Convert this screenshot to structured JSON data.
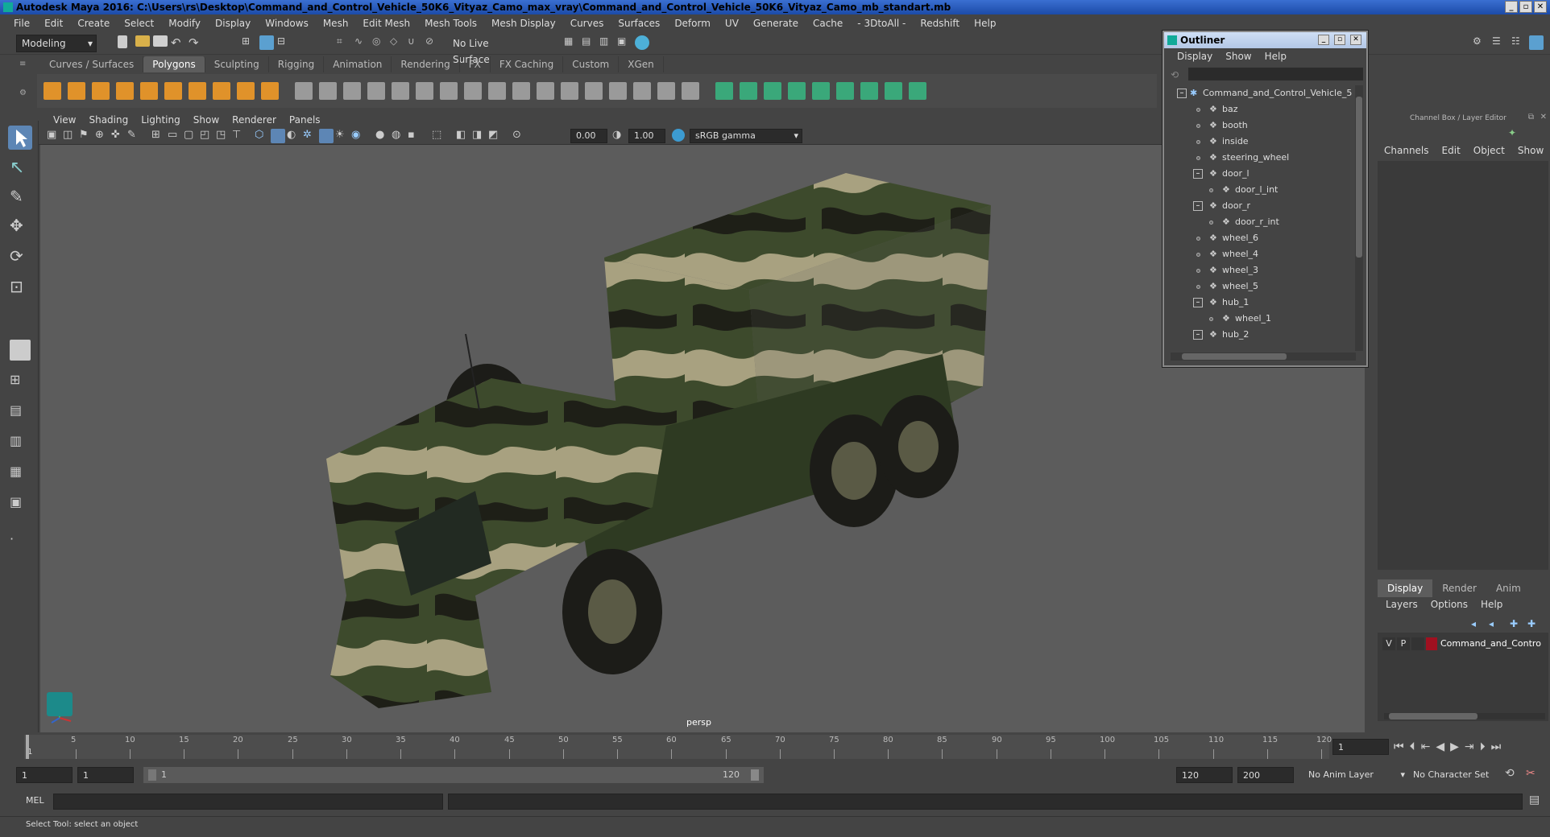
{
  "title": "Autodesk Maya 2016: C:\\Users\\rs\\Desktop\\Command_and_Control_Vehicle_50K6_Vityaz_Camo_max_vray\\Command_and_Control_Vehicle_50K6_Vityaz_Camo_mb_standart.mb",
  "menu": [
    "File",
    "Edit",
    "Create",
    "Select",
    "Modify",
    "Display",
    "Windows",
    "Mesh",
    "Edit Mesh",
    "Mesh Tools",
    "Mesh Display",
    "Curves",
    "Surfaces",
    "Deform",
    "UV",
    "Generate",
    "Cache",
    "- 3DtoAll -",
    "Redshift",
    "Help"
  ],
  "status": {
    "workspace": "Modeling",
    "live_surface": "No Live Surface"
  },
  "shelf_tabs": [
    "Curves / Surfaces",
    "Polygons",
    "Sculpting",
    "Rigging",
    "Animation",
    "Rendering",
    "FX",
    "FX Caching",
    "Custom",
    "XGen"
  ],
  "shelf_active": "Polygons",
  "panel_menu": [
    "View",
    "Shading",
    "Lighting",
    "Show",
    "Renderer",
    "Panels"
  ],
  "panel_fields": {
    "exposure": "0.00",
    "gamma": "1.00",
    "colorspace": "sRGB gamma"
  },
  "viewport": {
    "camera_label": "persp"
  },
  "outliner": {
    "title": "Outliner",
    "menu": [
      "Display",
      "Show",
      "Help"
    ],
    "items": [
      {
        "label": "Command_and_Control_Vehicle_5",
        "depth": 0,
        "expand": "-"
      },
      {
        "label": "baz",
        "depth": 1,
        "expand": ""
      },
      {
        "label": "booth",
        "depth": 1,
        "expand": ""
      },
      {
        "label": "inside",
        "depth": 1,
        "expand": ""
      },
      {
        "label": "steering_wheel",
        "depth": 1,
        "expand": ""
      },
      {
        "label": "door_l",
        "depth": 1,
        "expand": "-"
      },
      {
        "label": "door_l_int",
        "depth": 2,
        "expand": ""
      },
      {
        "label": "door_r",
        "depth": 1,
        "expand": "-"
      },
      {
        "label": "door_r_int",
        "depth": 2,
        "expand": ""
      },
      {
        "label": "wheel_6",
        "depth": 1,
        "expand": ""
      },
      {
        "label": "wheel_4",
        "depth": 1,
        "expand": ""
      },
      {
        "label": "wheel_3",
        "depth": 1,
        "expand": ""
      },
      {
        "label": "wheel_5",
        "depth": 1,
        "expand": ""
      },
      {
        "label": "hub_1",
        "depth": 1,
        "expand": "-"
      },
      {
        "label": "wheel_1",
        "depth": 2,
        "expand": ""
      },
      {
        "label": "hub_2",
        "depth": 1,
        "expand": "-"
      }
    ]
  },
  "channel_box": {
    "title": "Channel Box / Layer Editor",
    "tabs": [
      "Channels",
      "Edit",
      "Object",
      "Show"
    ],
    "layer_tabs": [
      "Display",
      "Render",
      "Anim"
    ],
    "layer_active": "Display",
    "layer_menu": [
      "Layers",
      "Options",
      "Help"
    ],
    "layer": {
      "v": "V",
      "p": "P",
      "name": "Command_and_Contro",
      "color": "#a01020"
    }
  },
  "timeline": {
    "ticks": [
      "5",
      "10",
      "15",
      "20",
      "25",
      "30",
      "35",
      "40",
      "45",
      "50",
      "55",
      "60",
      "65",
      "70",
      "75",
      "80",
      "85",
      "90",
      "95",
      "100",
      "105",
      "110",
      "115",
      "120"
    ],
    "start_tick": "1",
    "current_frame": "1"
  },
  "range": {
    "start": "1",
    "inner_start": "1",
    "slider_start": "1",
    "slider_end": "120",
    "end": "120",
    "max_end": "200",
    "anim_layer": "No Anim Layer",
    "char_set": "No Character Set"
  },
  "cmd": {
    "lang": "MEL"
  },
  "help": "Select Tool: select an object",
  "colors": {
    "camo_dark": "#3d4a2c",
    "camo_tan": "#a8a180",
    "camo_black": "#1e1f17"
  }
}
